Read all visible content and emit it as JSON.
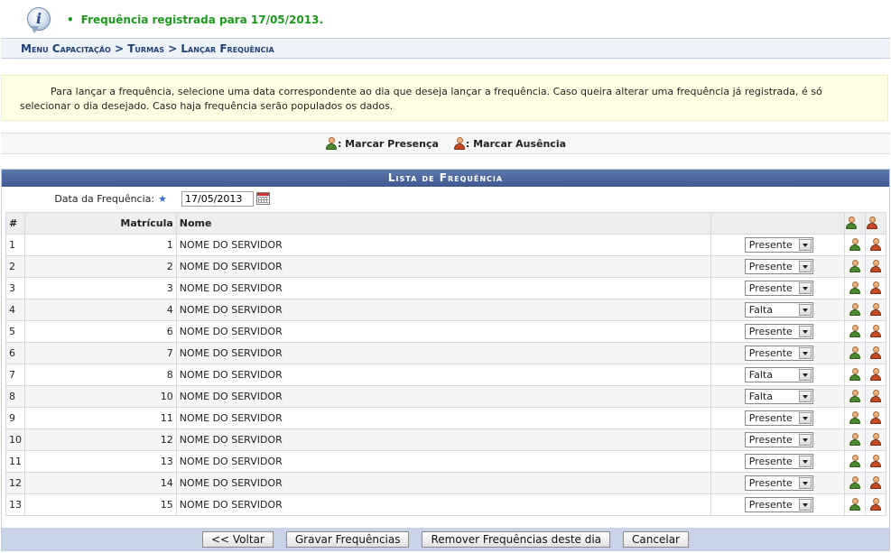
{
  "message": {
    "text": "Frequência registrada para 17/05/2013."
  },
  "breadcrumb": {
    "text": "Menu Capacitação > Turmas > Lançar Frequência"
  },
  "help": {
    "text": "Para lançar a frequência, selecione uma data correspondente ao dia que deseja lançar a frequência. Caso queira alterar uma frequência já registrada, é só selecionar o dia desejado. Caso haja frequência serão populados os dados."
  },
  "legend": {
    "presence": ": Marcar Presença",
    "absence": ": Marcar Ausência"
  },
  "panel": {
    "title": "Lista de Frequência"
  },
  "date": {
    "label": "Data da Frequência:",
    "required": "★",
    "value": "17/05/2013"
  },
  "table": {
    "headers": {
      "num": "#",
      "matricula": "Matrícula",
      "nome": "Nome"
    },
    "rows": [
      {
        "num": "1",
        "matricula": "1",
        "nome": "NOME DO SERVIDOR",
        "status": "Presente"
      },
      {
        "num": "2",
        "matricula": "2",
        "nome": "NOME DO SERVIDOR",
        "status": "Presente"
      },
      {
        "num": "3",
        "matricula": "3",
        "nome": "NOME DO SERVIDOR",
        "status": "Presente"
      },
      {
        "num": "4",
        "matricula": "4",
        "nome": "NOME DO SERVIDOR",
        "status": "Falta"
      },
      {
        "num": "5",
        "matricula": "6",
        "nome": "NOME DO SERVIDOR",
        "status": "Presente"
      },
      {
        "num": "6",
        "matricula": "7",
        "nome": "NOME DO SERVIDOR",
        "status": "Presente"
      },
      {
        "num": "7",
        "matricula": "8",
        "nome": "NOME DO SERVIDOR",
        "status": "Falta"
      },
      {
        "num": "8",
        "matricula": "10",
        "nome": "NOME DO SERVIDOR",
        "status": "Falta"
      },
      {
        "num": "9",
        "matricula": "11",
        "nome": "NOME DO SERVIDOR",
        "status": "Presente"
      },
      {
        "num": "10",
        "matricula": "12",
        "nome": "NOME DO SERVIDOR",
        "status": "Presente"
      },
      {
        "num": "11",
        "matricula": "13",
        "nome": "NOME DO SERVIDOR",
        "status": "Presente"
      },
      {
        "num": "12",
        "matricula": "14",
        "nome": "NOME DO SERVIDOR",
        "status": "Presente"
      },
      {
        "num": "13",
        "matricula": "15",
        "nome": "NOME DO SERVIDOR",
        "status": "Presente"
      }
    ]
  },
  "buttons": {
    "voltar": "<< Voltar",
    "gravar": "Gravar Frequências",
    "remover": "Remover Frequências deste dia",
    "cancelar": "Cancelar"
  },
  "colors": {
    "success": "#1d9a1d",
    "title_bar": "#3e5a92",
    "breadcrumb_text": "#1f3f78",
    "help_bg": "#ffffe4",
    "footer_bg": "#c8d3e8"
  },
  "icons": {
    "info": "info-icon",
    "presence": "person-green-check-icon",
    "absence": "person-red-x-icon",
    "calendar": "calendar-icon",
    "dropdown": "chevron-down-icon"
  }
}
